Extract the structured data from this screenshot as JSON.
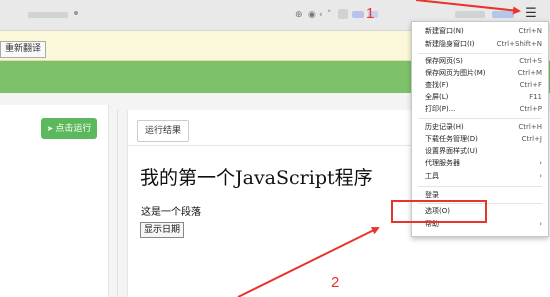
{
  "toolbar": {
    "zoom_icon": "magnifier",
    "back_icon": "chevron-left",
    "menu_icon": "hamburger"
  },
  "translate_bar": {
    "retranslate_label": "重新翻译"
  },
  "editor": {
    "run_label": "点击运行",
    "run_icon": "paper-plane"
  },
  "result": {
    "tab_label": "运行结果",
    "heading": "我的第一个JavaScript程序",
    "paragraph": "这是一个段落",
    "button_label": "显示日期"
  },
  "menu": {
    "items": [
      {
        "label": "新建窗口(N)",
        "shortcut": "Ctrl+N"
      },
      {
        "label": "新建隐身窗口(I)",
        "shortcut": "Ctrl+Shift+N"
      },
      {
        "label": "保存网页(S)",
        "shortcut": "Ctrl+S"
      },
      {
        "label": "保存网页为图片(M)",
        "shortcut": "Ctrl+M"
      },
      {
        "label": "查找(F)",
        "shortcut": "Ctrl+F"
      },
      {
        "label": "全屏(L)",
        "shortcut": "F11"
      },
      {
        "label": "打印(P)...",
        "shortcut": "Ctrl+P"
      },
      {
        "label": "历史记录(H)",
        "shortcut": "Ctrl+H"
      },
      {
        "label": "下载任务管理(D)",
        "shortcut": "Ctrl+J"
      },
      {
        "label": "设置界面样式(U)",
        "shortcut": ""
      },
      {
        "label": "代理服务器",
        "shortcut": ""
      },
      {
        "label": "工具",
        "shortcut": ""
      },
      {
        "label": "登录",
        "shortcut": ""
      },
      {
        "label": "选项(O)",
        "shortcut": ""
      },
      {
        "label": "帮助",
        "shortcut": ""
      }
    ]
  },
  "annotations": {
    "step1": "1",
    "step2": "2",
    "color": "#e8342a"
  }
}
